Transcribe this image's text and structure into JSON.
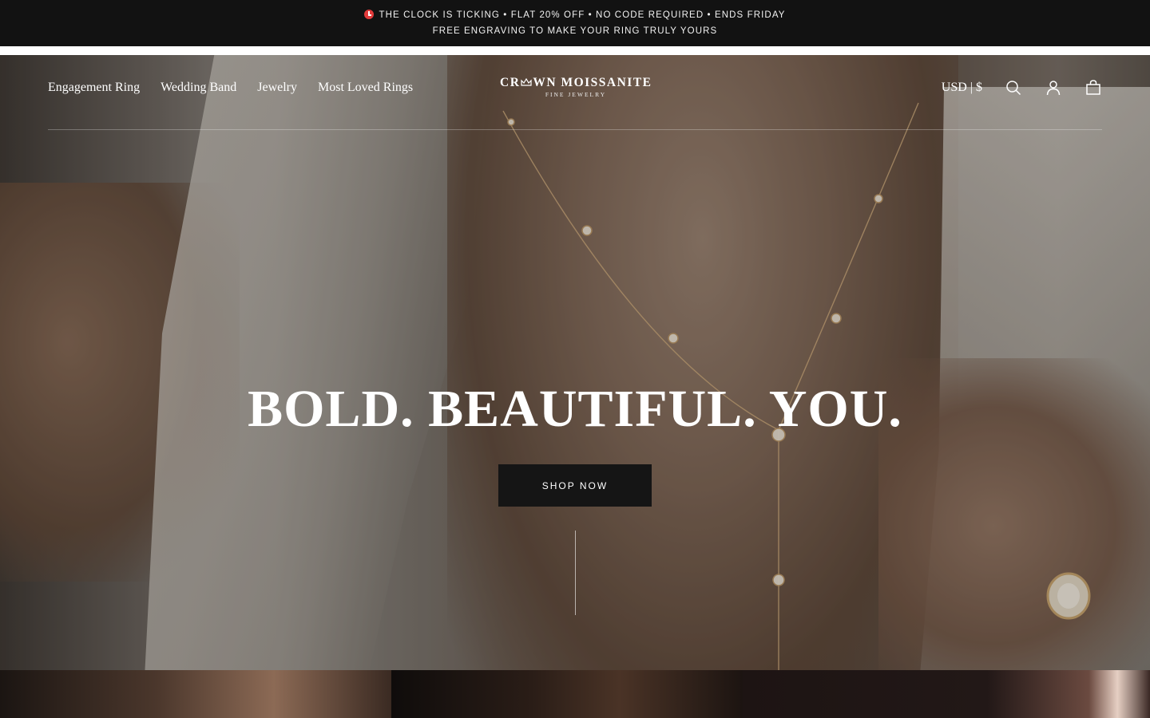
{
  "announcement": {
    "line1": "THE CLOCK IS TICKING • FLAT 20% OFF • NO CODE REQUIRED • ENDS FRIDAY",
    "line1_icon": "alarm-clock-icon",
    "line2": "FREE ENGRAVING TO MAKE YOUR RING TRULY YOURS"
  },
  "nav": {
    "items": [
      {
        "label": "Engagement Ring"
      },
      {
        "label": "Wedding Band"
      },
      {
        "label": "Jewelry"
      },
      {
        "label": "Most Loved Rings"
      }
    ]
  },
  "logo": {
    "name_left": "CR",
    "name_right": "WN MOISSANITE",
    "tagline": "FINE JEWELRY"
  },
  "utils": {
    "currency": "USD | $",
    "icons": [
      "search-icon",
      "account-icon",
      "cart-icon"
    ]
  },
  "hero": {
    "headline": "BOLD. BEAUTIFUL. YOU.",
    "cta_label": "SHOP NOW"
  },
  "colors": {
    "announcement_bg": "#121212",
    "button_bg": "#151515",
    "text_light": "#ffffff"
  }
}
